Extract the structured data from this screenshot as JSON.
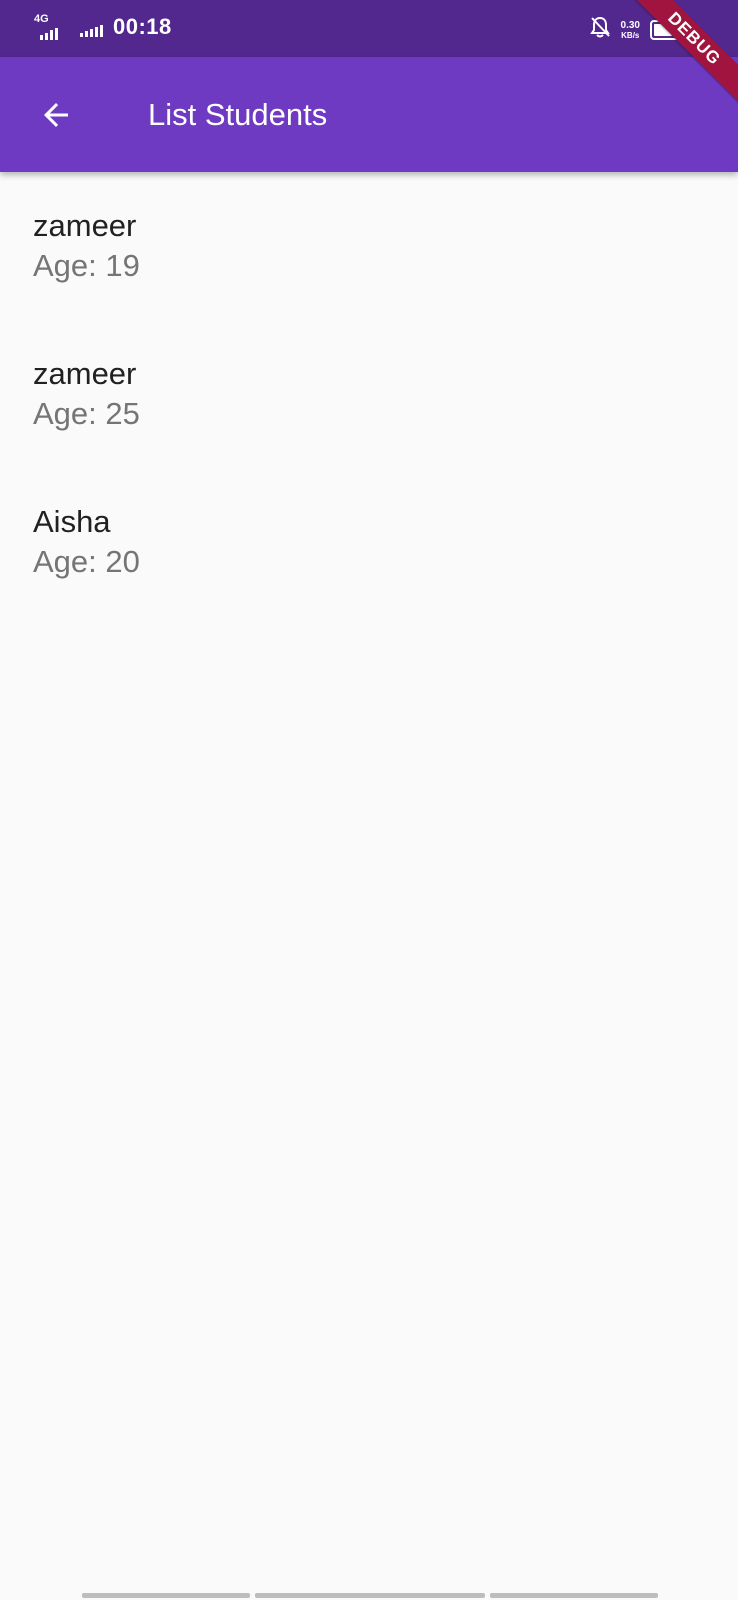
{
  "status_bar": {
    "network": "4G",
    "time": "00:18",
    "speed_value": "0.30",
    "speed_unit": "KB/s",
    "background": "#52288f"
  },
  "app_bar": {
    "title": "List Students",
    "back_icon": "arrow-back-icon",
    "background": "#6f3ac2"
  },
  "debug_banner": {
    "label": "DEBUG",
    "color": "#a0143f"
  },
  "students": [
    {
      "name": "zameer",
      "age": "Age: 19"
    },
    {
      "name": "zameer",
      "age": "Age: 25"
    },
    {
      "name": "Aisha",
      "age": "Age: 20"
    }
  ]
}
